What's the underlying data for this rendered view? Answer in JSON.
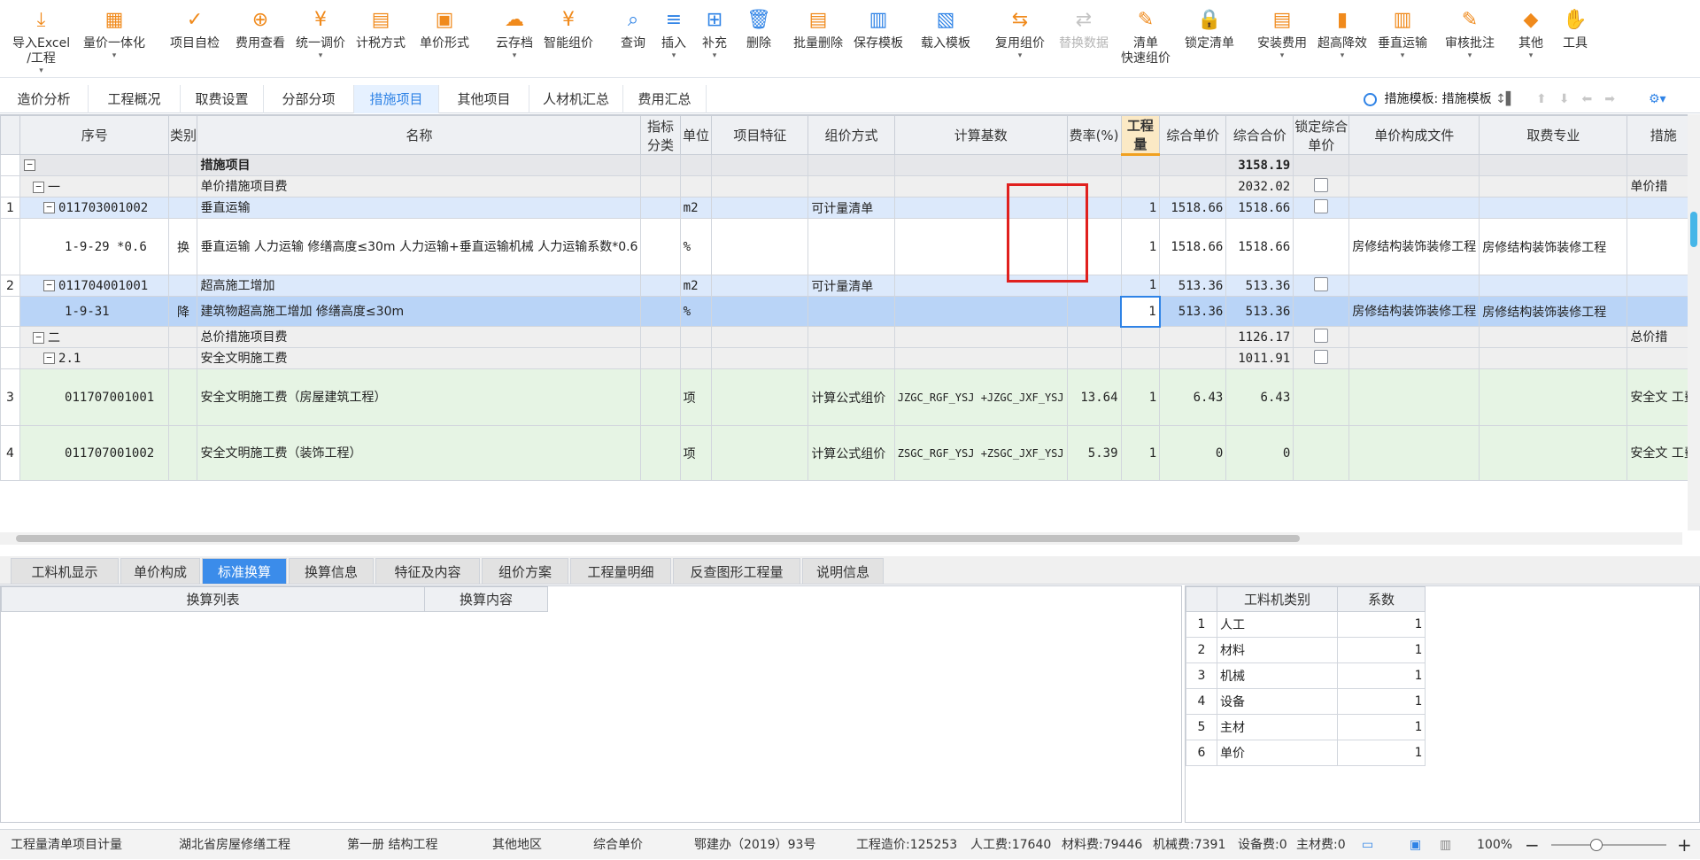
{
  "toolbar": {
    "buttons": [
      {
        "label": "导入Excel\n/工程",
        "icon": "import-excel-icon"
      },
      {
        "label": "量价一体化",
        "icon": "integration-icon"
      },
      {
        "label": "项目自检",
        "icon": "self-check-icon"
      },
      {
        "label": "费用查看",
        "icon": "fee-view-icon"
      },
      {
        "label": "统一调价",
        "icon": "adjust-price-icon"
      },
      {
        "label": "计税方式",
        "icon": "tax-method-icon"
      },
      {
        "label": "单价形式",
        "icon": "unit-price-form-icon"
      },
      {
        "label": "云存档",
        "icon": "cloud-archive-icon"
      },
      {
        "label": "智能组价",
        "icon": "smart-pricing-icon"
      },
      {
        "label": "查询",
        "icon": "query-icon"
      },
      {
        "label": "插入",
        "icon": "insert-icon"
      },
      {
        "label": "补充",
        "icon": "supplement-icon"
      },
      {
        "label": "删除",
        "icon": "delete-icon"
      },
      {
        "label": "批量删除",
        "icon": "batch-delete-icon"
      },
      {
        "label": "保存模板",
        "icon": "save-template-icon"
      },
      {
        "label": "载入模板",
        "icon": "load-template-icon"
      },
      {
        "label": "复用组价",
        "icon": "reuse-pricing-icon"
      },
      {
        "label": "替换数据",
        "icon": "replace-data-icon"
      },
      {
        "label": "清单\n快速组价",
        "icon": "quick-pricing-icon"
      },
      {
        "label": "锁定清单",
        "icon": "lock-list-icon"
      },
      {
        "label": "安装费用",
        "icon": "install-fee-icon"
      },
      {
        "label": "超高降效",
        "icon": "high-efficiency-icon"
      },
      {
        "label": "垂直运输",
        "icon": "vertical-transport-icon"
      },
      {
        "label": "审核批注",
        "icon": "review-note-icon"
      },
      {
        "label": "其他",
        "icon": "other-icon"
      },
      {
        "label": "工具",
        "icon": "tools-icon"
      }
    ]
  },
  "tabs": [
    "造价分析",
    "工程概况",
    "取费设置",
    "分部分项",
    "措施项目",
    "其他项目",
    "人材机汇总",
    "费用汇总"
  ],
  "template_label": "措施模板: 措施模板",
  "grid": {
    "headers": [
      "序号",
      "类别",
      "名称",
      "指标分类",
      "单位",
      "项目特征",
      "组价方式",
      "计算基数",
      "费率(%)",
      "工程量",
      "综合单价",
      "综合合价",
      "锁定综合单价",
      "单价构成文件",
      "取费专业",
      "措施"
    ],
    "rows": [
      {
        "idx": "",
        "code": "",
        "type": "",
        "name": "措施项目",
        "unit": "",
        "method": "",
        "base": "",
        "rate": "",
        "qty": "",
        "unit_price": "",
        "total": "3158.19",
        "file": "",
        "major": "",
        "extra": ""
      },
      {
        "idx": "",
        "code": "一",
        "type": "",
        "name": "单价措施项目费",
        "unit": "",
        "method": "",
        "base": "",
        "rate": "",
        "qty": "",
        "unit_price": "",
        "total": "2032.02",
        "file": "",
        "major": "",
        "extra": "单价措"
      },
      {
        "idx": "1",
        "code": "011703001002",
        "type": "",
        "name": "垂直运输",
        "unit": "m2",
        "method": "可计量清单",
        "base": "",
        "rate": "",
        "qty": "1",
        "unit_price": "1518.66",
        "total": "1518.66",
        "file": "",
        "major": "",
        "extra": ""
      },
      {
        "idx": "",
        "code": "1-9-29 *0.6",
        "type": "换",
        "name": "垂直运输 人力运输 修缮高度≤30m  人力运输+垂直运输机械 人力运输系数*0.6",
        "unit": "%",
        "method": "",
        "base": "",
        "rate": "",
        "qty": "1",
        "unit_price": "1518.66",
        "total": "1518.66",
        "file": "房修结构装饰装修工程",
        "major": "房修结构装饰装修工程",
        "extra": ""
      },
      {
        "idx": "2",
        "code": "011704001001",
        "type": "",
        "name": "超高施工增加",
        "unit": "m2",
        "method": "可计量清单",
        "base": "",
        "rate": "",
        "qty": "1",
        "unit_price": "513.36",
        "total": "513.36",
        "file": "",
        "major": "",
        "extra": ""
      },
      {
        "idx": "",
        "code": "1-9-31",
        "type": "降",
        "name": "建筑物超高施工增加 修缮高度≤30m",
        "unit": "%",
        "method": "",
        "base": "",
        "rate": "",
        "qty": "1",
        "unit_price": "513.36",
        "total": "513.36",
        "file": "房修结构装饰装修工程",
        "major": "房修结构装饰装修工程",
        "extra": ""
      },
      {
        "idx": "",
        "code": "二",
        "type": "",
        "name": "总价措施项目费",
        "unit": "",
        "method": "",
        "base": "",
        "rate": "",
        "qty": "",
        "unit_price": "",
        "total": "1126.17",
        "file": "",
        "major": "",
        "extra": "总价措"
      },
      {
        "idx": "",
        "code": "2.1",
        "type": "",
        "name": "安全文明施工费",
        "unit": "",
        "method": "",
        "base": "",
        "rate": "",
        "qty": "",
        "unit_price": "",
        "total": "1011.91",
        "file": "",
        "major": "",
        "extra": ""
      },
      {
        "idx": "3",
        "code": "011707001001",
        "type": "",
        "name": "安全文明施工费（房屋建筑工程）",
        "unit": "项",
        "method": "计算公式组价",
        "base": "JZGC_RGF_YSJ +JZGC_JXF_YSJ",
        "rate": "13.64",
        "qty": "1",
        "unit_price": "6.43",
        "total": "6.43",
        "file": "",
        "major": "",
        "extra": "安全文 工费"
      },
      {
        "idx": "4",
        "code": "011707001002",
        "type": "",
        "name": "安全文明施工费（装饰工程）",
        "unit": "项",
        "method": "计算公式组价",
        "base": "ZSGC_RGF_YSJ +ZSGC_JXF_YSJ",
        "rate": "5.39",
        "qty": "1",
        "unit_price": "0",
        "total": "0",
        "file": "",
        "major": "",
        "extra": "安全文 工费"
      }
    ]
  },
  "bottom_tabs": [
    "工料机显示",
    "单价构成",
    "标准换算",
    "换算信息",
    "特征及内容",
    "组价方案",
    "工程量明细",
    "反查图形工程量",
    "说明信息"
  ],
  "conv_headers": [
    "换算列表",
    "换算内容"
  ],
  "coef": {
    "headers": [
      "工料机类别",
      "系数"
    ],
    "rows": [
      {
        "n": "1",
        "cat": "人工",
        "v": "1"
      },
      {
        "n": "2",
        "cat": "材料",
        "v": "1"
      },
      {
        "n": "3",
        "cat": "机械",
        "v": "1"
      },
      {
        "n": "4",
        "cat": "设备",
        "v": "1"
      },
      {
        "n": "5",
        "cat": "主材",
        "v": "1"
      },
      {
        "n": "6",
        "cat": "单价",
        "v": "1"
      }
    ]
  },
  "status": {
    "mode": "工程量清单项目计量",
    "region": "湖北省房屋修缮工程",
    "volume": "第一册 结构工程",
    "area": "其他地区",
    "price_type": "综合单价",
    "doc": "鄂建办（2019）93号",
    "cost": "工程造价:125253",
    "labor": "人工费:17640",
    "material": "材料费:79446",
    "machine": "机械费:7391",
    "equipment": "设备费:0",
    "main_material": "主材费:0",
    "zoom": "100%"
  },
  "colors": {
    "accent": "#2f83e6",
    "selected_row": "#b9d4f7",
    "highlight_box": "#e0201e"
  }
}
